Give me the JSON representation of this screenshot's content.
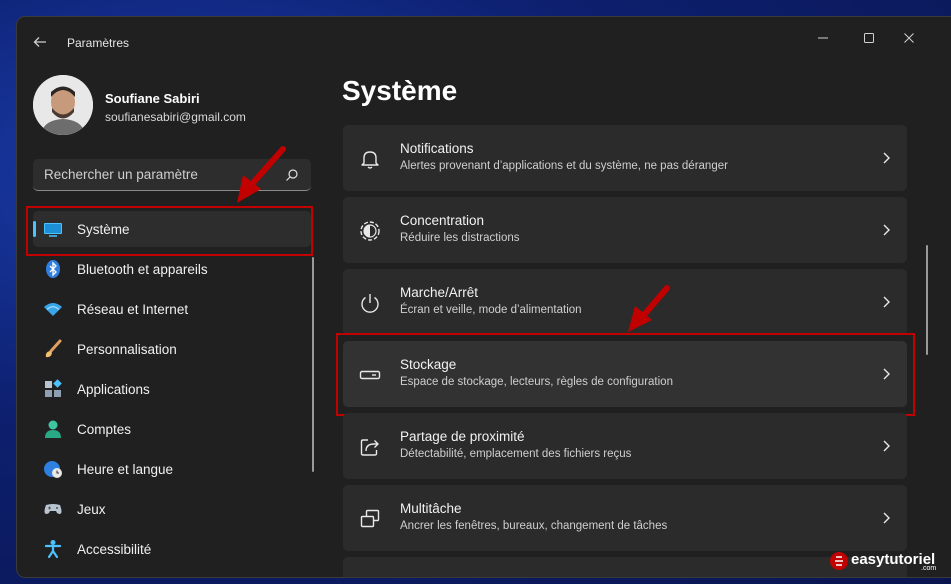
{
  "window": {
    "title": "Paramètres"
  },
  "user": {
    "name": "Soufiane Sabiri",
    "email": "soufianesabiri@gmail.com"
  },
  "search": {
    "placeholder": "Rechercher un paramètre"
  },
  "sidebar": {
    "items": [
      {
        "label": "Système",
        "icon": "display-icon",
        "active": true
      },
      {
        "label": "Bluetooth et appareils",
        "icon": "bluetooth-icon"
      },
      {
        "label": "Réseau et Internet",
        "icon": "wifi-icon"
      },
      {
        "label": "Personnalisation",
        "icon": "brush-icon"
      },
      {
        "label": "Applications",
        "icon": "apps-icon"
      },
      {
        "label": "Comptes",
        "icon": "person-icon"
      },
      {
        "label": "Heure et langue",
        "icon": "globe-clock-icon"
      },
      {
        "label": "Jeux",
        "icon": "gamepad-icon"
      },
      {
        "label": "Accessibilité",
        "icon": "accessibility-icon"
      }
    ]
  },
  "main": {
    "title": "Système",
    "cards": [
      {
        "title": "Notifications",
        "subtitle": "Alertes provenant d’applications et du système, ne pas déranger",
        "icon": "bell-icon"
      },
      {
        "title": "Concentration",
        "subtitle": "Réduire les distractions",
        "icon": "focus-icon"
      },
      {
        "title": "Marche/Arrêt",
        "subtitle": "Écran et veille, mode d’alimentation",
        "icon": "power-icon"
      },
      {
        "title": "Stockage",
        "subtitle": "Espace de stockage, lecteurs, règles de configuration",
        "icon": "storage-icon",
        "highlighted": true
      },
      {
        "title": "Partage de proximité",
        "subtitle": "Détectabilité, emplacement des fichiers reçus",
        "icon": "share-icon"
      },
      {
        "title": "Multitâche",
        "subtitle": "Ancrer les fenêtres, bureaux, changement de tâches",
        "icon": "multitask-icon"
      }
    ]
  },
  "watermark": {
    "text": "easytutoriel",
    "suffix": ".com"
  },
  "colors": {
    "accent": "#4cc2ff",
    "highlight": "#c10000",
    "window_bg": "#202020",
    "card_bg": "#2b2b2b"
  }
}
